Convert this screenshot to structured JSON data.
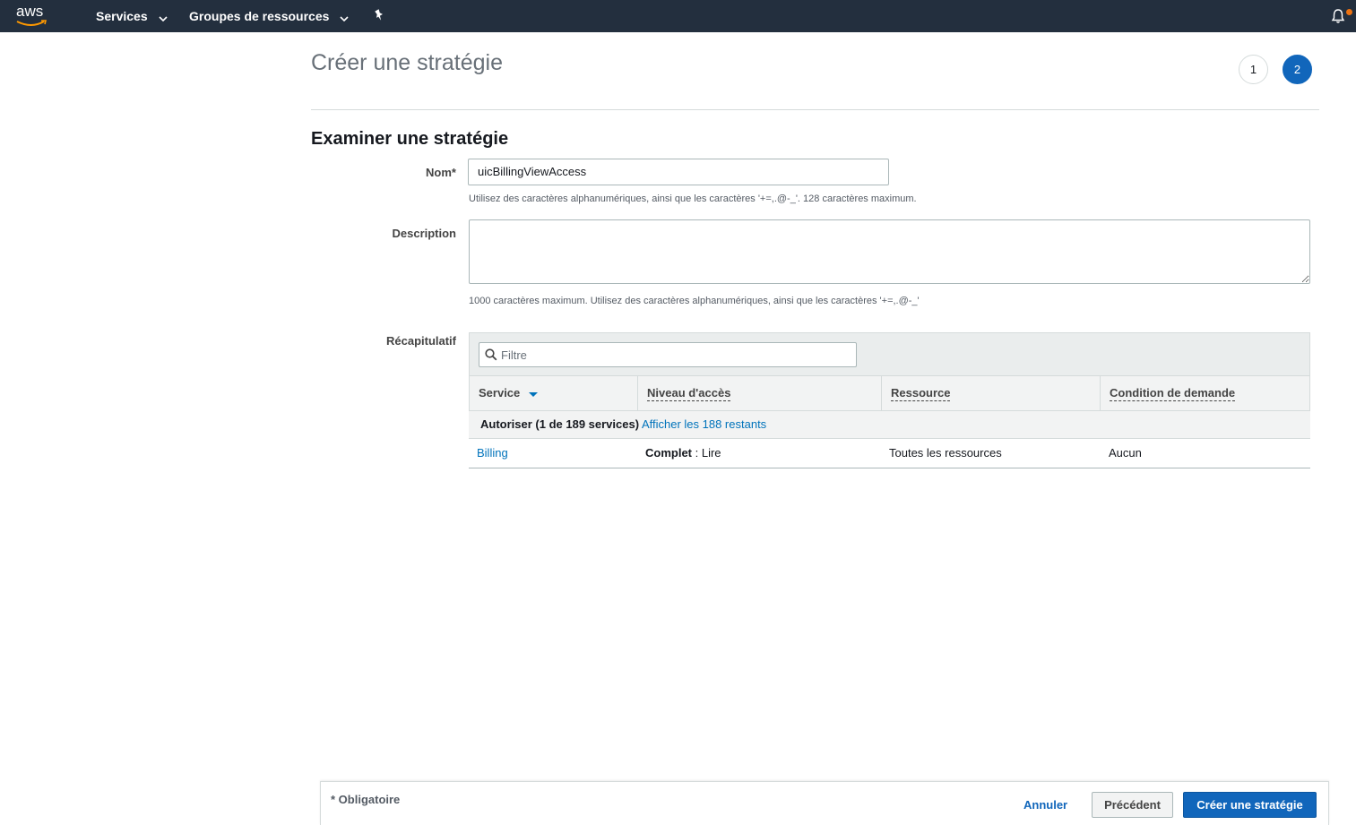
{
  "topnav": {
    "logo": "aws",
    "services_label": "Services",
    "resource_groups_label": "Groupes de ressources",
    "pin_icon": "pin-icon",
    "bell_icon": "bell-icon",
    "accent_color": "#ec7211"
  },
  "header": {
    "title": "Créer une stratégie",
    "steps": [
      "1",
      "2"
    ],
    "active_step": "2"
  },
  "form": {
    "section_title": "Examiner une stratégie",
    "name_label": "Nom*",
    "name_value": "uicBillingViewAccess",
    "name_hint": "Utilisez des caractères alphanumériques, ainsi que les caractères '+=,.@-_'. 128 caractères maximum.",
    "description_label": "Description",
    "description_value": "",
    "description_hint": "1000 caractères maximum. Utilisez des caractères alphanumériques, ainsi que les caractères '+=,.@-_'",
    "summary_label": "Récapitulatif"
  },
  "summary": {
    "filter_placeholder": "Filtre",
    "columns": [
      "Service",
      "Niveau d'accès",
      "Ressource",
      "Condition de demande"
    ],
    "group": {
      "text": "Autoriser (1 de 189 services)",
      "link": "Afficher les 188 restants"
    },
    "rows": [
      {
        "service": "Billing",
        "access_bold": "Complet",
        "access_rest": " : Lire",
        "resource": "Toutes les ressources",
        "condition": "Aucun"
      }
    ]
  },
  "footer": {
    "required_note": "* Obligatoire",
    "cancel_label": "Annuler",
    "previous_label": "Précédent",
    "create_label": "Créer une stratégie",
    "primary_color": "#1166bb"
  }
}
